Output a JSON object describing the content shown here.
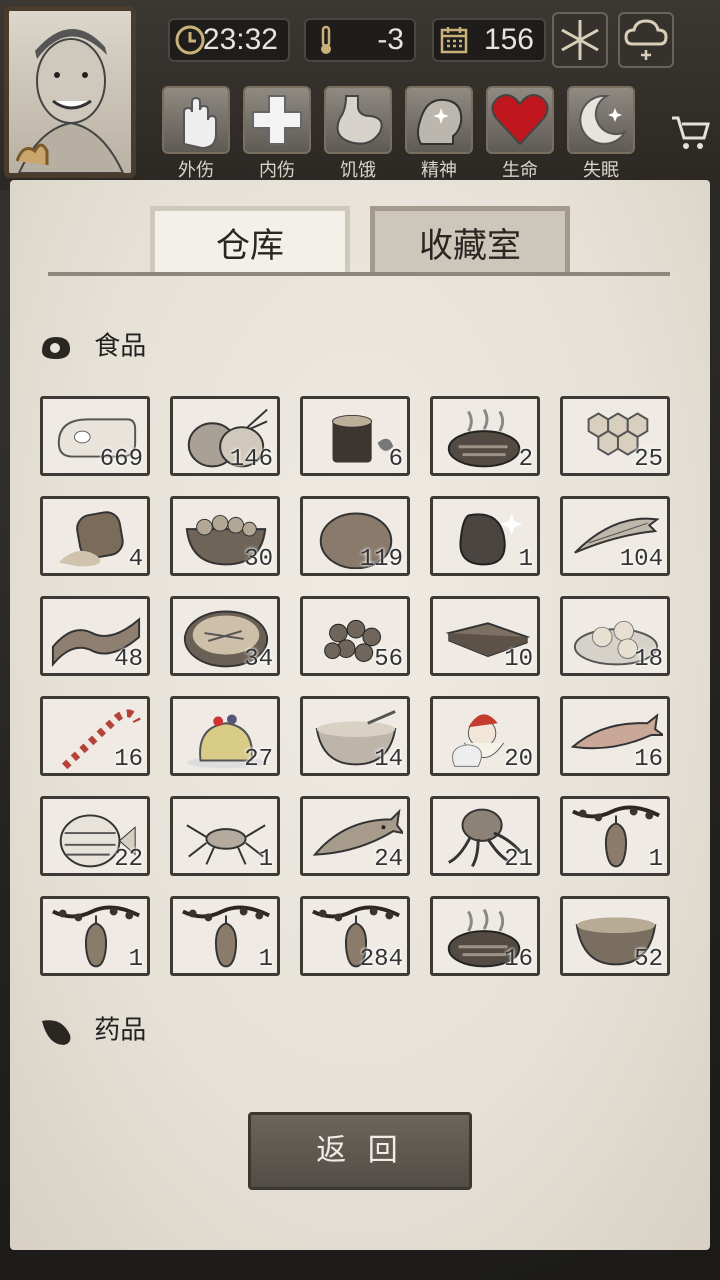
{
  "hud": {
    "time": "23:32",
    "temperature": "-3",
    "days": "156",
    "status_labels": [
      "外伤",
      "内伤",
      "饥饿",
      "精神",
      "生命",
      "失眠"
    ]
  },
  "tabs": {
    "warehouse": "仓库",
    "collection": "收藏室"
  },
  "sections": {
    "food": "食品",
    "medicine": "药品"
  },
  "food_items": [
    {
      "icon": "raw-meat-icon",
      "count": "669"
    },
    {
      "icon": "onion-icon",
      "count": "146"
    },
    {
      "icon": "wood-log-icon",
      "count": "6"
    },
    {
      "icon": "steak-icon",
      "count": "2"
    },
    {
      "icon": "honeycomb-icon",
      "count": "25"
    },
    {
      "icon": "barrel-icon",
      "count": "4"
    },
    {
      "icon": "nut-bowl-icon",
      "count": "30"
    },
    {
      "icon": "potato-icon",
      "count": "119"
    },
    {
      "icon": "bean-icon",
      "count": "1"
    },
    {
      "icon": "dried-fish-icon",
      "count": "104"
    },
    {
      "icon": "bacon-icon",
      "count": "48"
    },
    {
      "icon": "salad-bowl-icon",
      "count": "34"
    },
    {
      "icon": "berries-icon",
      "count": "56"
    },
    {
      "icon": "chocolate-icon",
      "count": "10"
    },
    {
      "icon": "dumplings-icon",
      "count": "18"
    },
    {
      "icon": "candy-cane-icon",
      "count": "16"
    },
    {
      "icon": "jelly-cake-icon",
      "count": "27"
    },
    {
      "icon": "porridge-icon",
      "count": "14"
    },
    {
      "icon": "santa-icon",
      "count": "20"
    },
    {
      "icon": "salmon-icon",
      "count": "16"
    },
    {
      "icon": "butterfly-fish-icon",
      "count": "22"
    },
    {
      "icon": "crab-icon",
      "count": "1"
    },
    {
      "icon": "cod-fish-icon",
      "count": "24"
    },
    {
      "icon": "squid-icon",
      "count": "21"
    },
    {
      "icon": "hanging-gourd-icon",
      "count": "1"
    },
    {
      "icon": "hanging-gourd-icon",
      "count": "1"
    },
    {
      "icon": "hanging-gourd-icon",
      "count": "1"
    },
    {
      "icon": "hanging-gourd-icon",
      "count": "284"
    },
    {
      "icon": "steak-icon",
      "count": "16"
    },
    {
      "icon": "soup-bowl-icon",
      "count": "52"
    }
  ],
  "back_button": "返 回",
  "colors": {
    "paper": "#e9e5dd",
    "frame": "#3d3a36",
    "heart": "#c0161e"
  }
}
